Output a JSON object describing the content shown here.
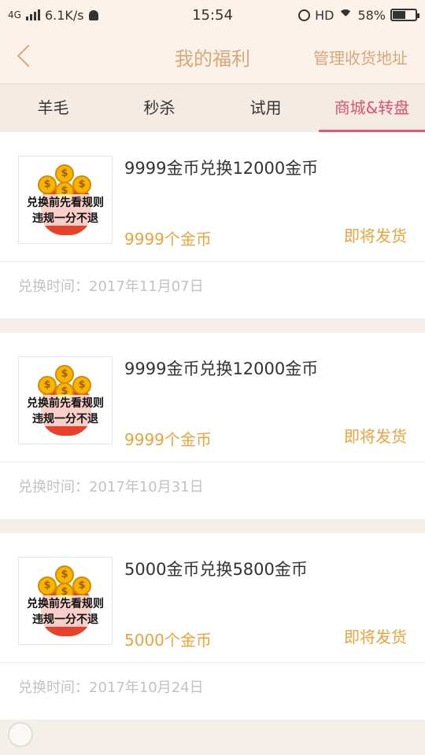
{
  "status_bar": {
    "network": "4G",
    "speed": "6.1K/s",
    "time": "15:54",
    "hd": "HD",
    "battery": "58%",
    "battery_level": 0.58
  },
  "nav": {
    "title": "我的福利",
    "action": "管理收货地址"
  },
  "tabs": [
    {
      "label": "羊毛"
    },
    {
      "label": "秒杀"
    },
    {
      "label": "试用"
    },
    {
      "label": "商城&转盘",
      "active": true
    }
  ],
  "thumb": {
    "line1": "兑换前先看规则",
    "line2": "违规一分不退"
  },
  "items": [
    {
      "title": "9999金币兑换12000金币",
      "price": "9999个金币",
      "status": "即将发货",
      "time": "兑换时间：2017年11月07日"
    },
    {
      "title": "9999金币兑换12000金币",
      "price": "9999个金币",
      "status": "即将发货",
      "time": "兑换时间：2017年10月31日"
    },
    {
      "title": "5000金币兑换5800金币",
      "price": "5000个金币",
      "status": "即将发货",
      "time": "兑换时间：2017年10月24日"
    }
  ],
  "colors": {
    "accent": "#d9a77a",
    "active_tab": "#e0536b",
    "price": "#f0a23a"
  }
}
